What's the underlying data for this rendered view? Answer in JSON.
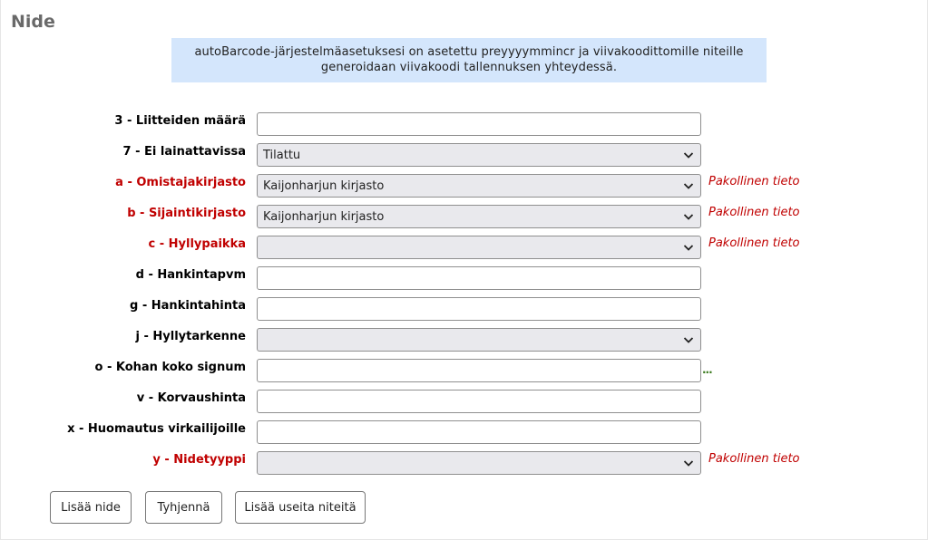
{
  "page": {
    "title": "Nide",
    "notice": "autoBarcode-järjestelmäasetuksesi on asetettu preyyyymmincr ja viivakoodittomille niteille generoidaan viivakoodi tallennuksen yhteydessä."
  },
  "form": {
    "required_note": "Pakollinen tieto",
    "fields": [
      {
        "label": "3 - Liitteiden määrä",
        "type": "text",
        "value": ""
      },
      {
        "label": "7 - Ei lainattavissa",
        "type": "select",
        "value": "Tilattu"
      },
      {
        "label": "a - Omistajakirjasto",
        "type": "select",
        "value": "Kaijonharjun kirjasto",
        "required": true
      },
      {
        "label": "b - Sijaintikirjasto",
        "type": "select",
        "value": "Kaijonharjun kirjasto",
        "required": true
      },
      {
        "label": "c - Hyllypaikka",
        "type": "select",
        "value": "",
        "required": true
      },
      {
        "label": "d - Hankintapvm",
        "type": "text",
        "value": ""
      },
      {
        "label": "g - Hankintahinta",
        "type": "text",
        "value": ""
      },
      {
        "label": "j - Hyllytarkenne",
        "type": "select",
        "value": ""
      },
      {
        "label": "o - Kohan koko signum",
        "type": "text",
        "value": "",
        "extra": "..."
      },
      {
        "label": "v - Korvaushinta",
        "type": "text",
        "value": ""
      },
      {
        "label": "x - Huomautus virkailijoille",
        "type": "text",
        "value": ""
      },
      {
        "label": "y - Nidetyyppi",
        "type": "select",
        "value": "",
        "required": true
      }
    ]
  },
  "buttons": {
    "add_item": "Lisää nide",
    "clear": "Tyhjennä",
    "add_multiple": "Lisää useita niteitä"
  },
  "colors": {
    "required": "#c00000",
    "notice_bg": "#d4e6fc",
    "title": "#696969"
  }
}
